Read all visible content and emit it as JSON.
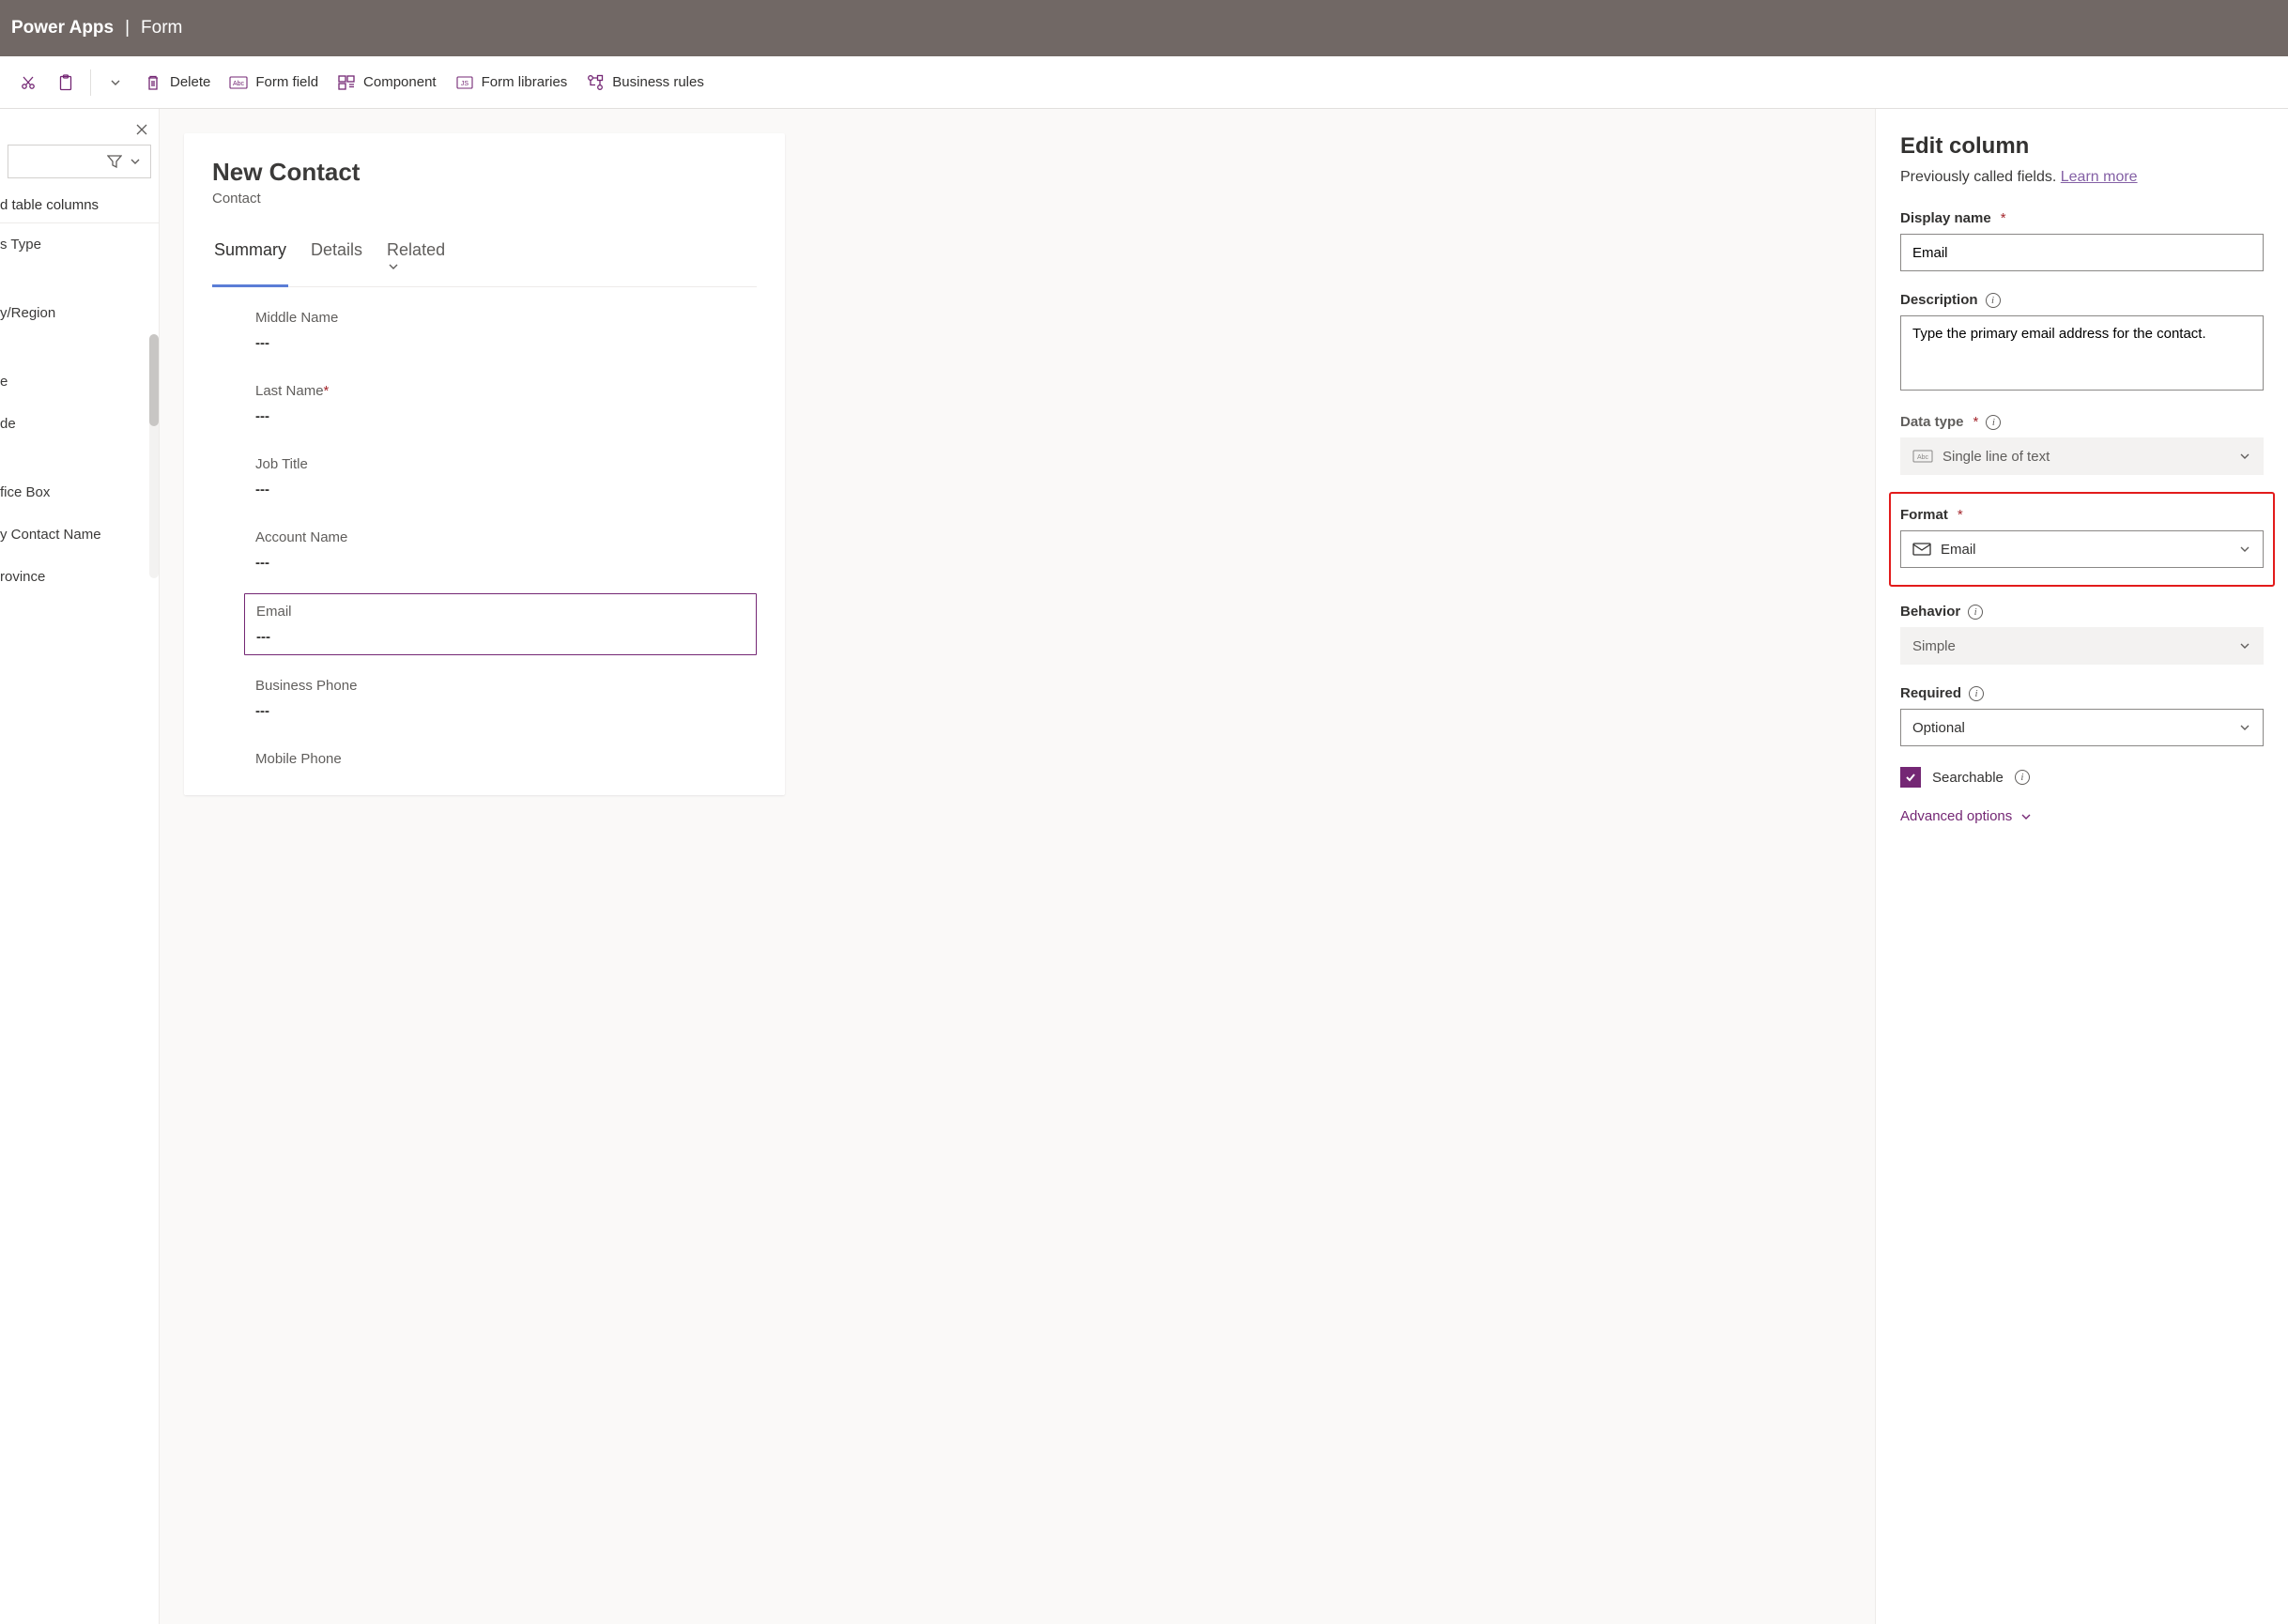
{
  "header": {
    "app": "Power Apps",
    "page": "Form"
  },
  "toolbar": {
    "delete": "Delete",
    "form_field": "Form field",
    "component": "Component",
    "form_libraries": "Form libraries",
    "business_rules": "Business rules"
  },
  "leftcol": {
    "section": "d table columns",
    "items": [
      "s Type",
      "",
      "y/Region",
      "",
      "e",
      "de",
      "",
      "fice Box",
      "y Contact Name",
      "rovince"
    ]
  },
  "form": {
    "title": "New Contact",
    "subtitle": "Contact",
    "tabs": {
      "summary": "Summary",
      "details": "Details",
      "related": "Related"
    },
    "fields": {
      "middle_name": {
        "label": "Middle Name",
        "value": "---"
      },
      "last_name": {
        "label": "Last Name",
        "value": "---"
      },
      "job_title": {
        "label": "Job Title",
        "value": "---"
      },
      "account_name": {
        "label": "Account Name",
        "value": "---"
      },
      "email": {
        "label": "Email",
        "value": "---"
      },
      "business_phone": {
        "label": "Business Phone",
        "value": "---"
      },
      "mobile_phone": {
        "label": "Mobile Phone",
        "value": ""
      }
    }
  },
  "panel": {
    "title": "Edit column",
    "subtext_prefix": "Previously called fields. ",
    "learn_more": "Learn more",
    "display_name": {
      "label": "Display name",
      "value": "Email"
    },
    "description": {
      "label": "Description",
      "value": "Type the primary email address for the contact."
    },
    "data_type": {
      "label": "Data type",
      "value": "Single line of text"
    },
    "format": {
      "label": "Format",
      "value": "Email"
    },
    "behavior": {
      "label": "Behavior",
      "value": "Simple"
    },
    "required": {
      "label": "Required",
      "value": "Optional"
    },
    "searchable": "Searchable",
    "advanced": "Advanced options"
  }
}
